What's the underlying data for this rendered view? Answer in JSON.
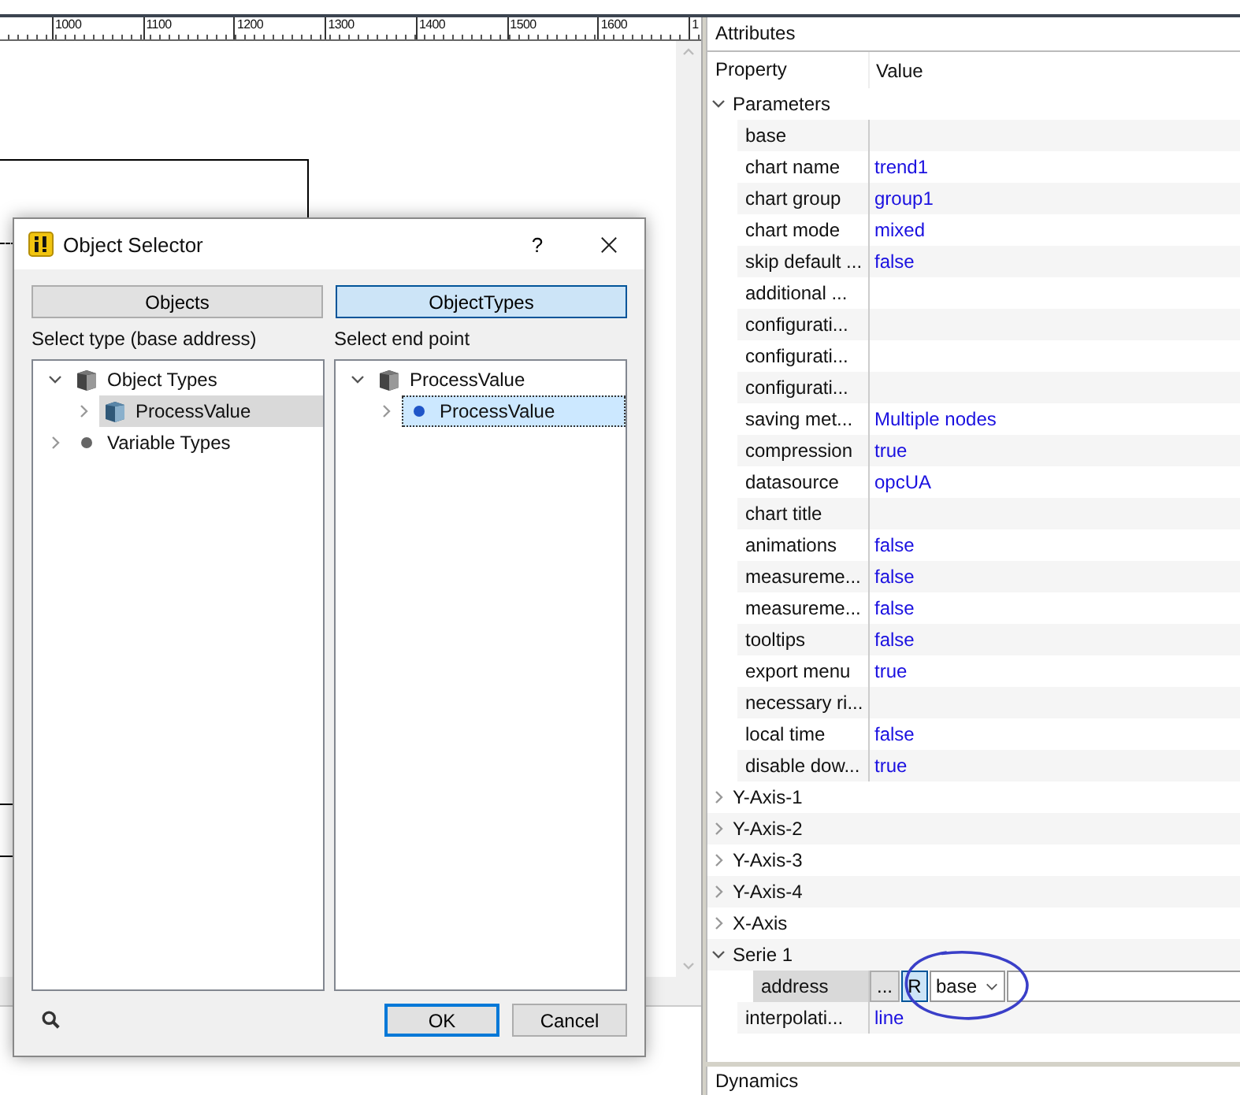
{
  "ruler": {
    "labels": [
      "1000",
      "1100",
      "1200",
      "1300",
      "1400",
      "1500",
      "1600",
      "1"
    ]
  },
  "dialog": {
    "title": "Object Selector",
    "help": "?",
    "tabs": [
      {
        "label": "Objects",
        "selected": false
      },
      {
        "label": "ObjectTypes",
        "selected": true
      }
    ],
    "left": {
      "label": "Select type (base address)",
      "tree": [
        {
          "label": "Object Types",
          "kind": "object",
          "expanded": true,
          "selected": false,
          "children": [
            {
              "label": "ProcessValue",
              "kind": "type",
              "expanded": false,
              "selected": true
            }
          ]
        },
        {
          "label": "Variable Types",
          "kind": "variable",
          "expanded": false,
          "selected": false
        }
      ]
    },
    "right": {
      "label": "Select end point",
      "tree": [
        {
          "label": "ProcessValue",
          "kind": "object",
          "expanded": true,
          "selected": false,
          "children": [
            {
              "label": "ProcessValue",
              "kind": "endpoint",
              "expanded": false,
              "selected": true
            }
          ]
        }
      ]
    },
    "buttons": [
      {
        "label": "OK",
        "default": true
      },
      {
        "label": "Cancel",
        "default": false
      }
    ]
  },
  "attributes": {
    "title": "Attributes",
    "columns": [
      "Property",
      "Value"
    ],
    "groups": [
      {
        "label": "Parameters",
        "expanded": true,
        "children": [
          {
            "kind": "text",
            "property": "base"
          },
          {
            "kind": "text",
            "property": "chart name",
            "value": "trend1"
          },
          {
            "kind": "text",
            "property": "chart group",
            "value": "group1"
          },
          {
            "kind": "text",
            "property": "chart mode",
            "value": "mixed"
          },
          {
            "kind": "text",
            "property": "skip default ...",
            "value": "false"
          },
          {
            "kind": "text",
            "property": "additional ..."
          },
          {
            "kind": "text",
            "property": "configurati..."
          },
          {
            "kind": "text",
            "property": "configurati..."
          },
          {
            "kind": "text",
            "property": "configurati..."
          },
          {
            "kind": "text",
            "property": "saving met...",
            "value": "Multiple nodes"
          },
          {
            "kind": "text",
            "property": "compression",
            "value": "true"
          },
          {
            "kind": "text",
            "property": "datasource",
            "value": "opcUA"
          },
          {
            "kind": "text",
            "property": "chart title"
          },
          {
            "kind": "text",
            "property": "animations",
            "value": "false"
          },
          {
            "kind": "text",
            "property": "measureme...",
            "value": "false"
          },
          {
            "kind": "text",
            "property": "measureme...",
            "value": "false"
          },
          {
            "kind": "text",
            "property": "tooltips",
            "value": "false"
          },
          {
            "kind": "text",
            "property": "export menu",
            "value": "true"
          },
          {
            "kind": "text",
            "property": "necessary ri..."
          },
          {
            "kind": "text",
            "property": "local time",
            "value": "false"
          },
          {
            "kind": "text",
            "property": "disable dow...",
            "value": "true"
          }
        ]
      },
      {
        "label": "Y-Axis-1",
        "expanded": false
      },
      {
        "label": "Y-Axis-2",
        "expanded": false
      },
      {
        "label": "Y-Axis-3",
        "expanded": false
      },
      {
        "label": "Y-Axis-4",
        "expanded": false
      },
      {
        "label": "X-Axis",
        "expanded": false
      },
      {
        "label": "Serie 1",
        "expanded": true,
        "children": [
          {
            "kind": "address",
            "property": "address",
            "selected": true,
            "browse": "...",
            "mode": "R",
            "source": "base"
          },
          {
            "kind": "text",
            "property": "interpolati...",
            "value": "line"
          }
        ]
      }
    ]
  },
  "dynamics": {
    "title": "Dynamics"
  }
}
